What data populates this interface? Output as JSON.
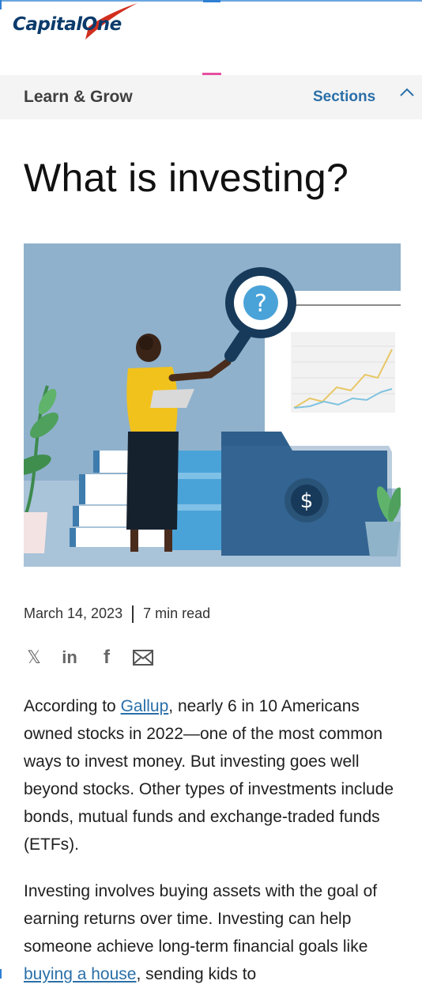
{
  "brand": {
    "logo_text": "CapitalOne"
  },
  "subnav": {
    "title": "Learn & Grow",
    "sections_label": "Sections"
  },
  "article": {
    "title": "What is investing?",
    "date": "March 14, 2023",
    "read_time": "7 min read",
    "hero_alt": "",
    "share_icons": [
      "x-icon",
      "linkedin-icon",
      "facebook-icon",
      "email-icon"
    ],
    "share_glyphs": {
      "x": "𝕏",
      "linkedin": "in",
      "facebook": "f"
    },
    "paragraph1": {
      "before": "According to ",
      "link": "Gallup",
      "after": ", nearly 6 in 10 Americans owned stocks in 2022—one of the most common ways to invest money. But investing goes well beyond stocks. Other types of investments include bonds, mutual funds and exchange-traded funds (ETFs)."
    },
    "paragraph2": {
      "before": "Investing involves buying assets with the goal of earning returns over time. Investing can help someone achieve long-term financial goals like ",
      "link": "buying a house",
      "after": ", sending kids to"
    }
  },
  "colors": {
    "accent": "#2a6fa8",
    "brand_navy": "#0b3b6b",
    "brand_red": "#d22e1e",
    "subnav_bg": "#f4f4f4"
  },
  "hero_labels": {
    "question": "?",
    "dollar": "$"
  }
}
